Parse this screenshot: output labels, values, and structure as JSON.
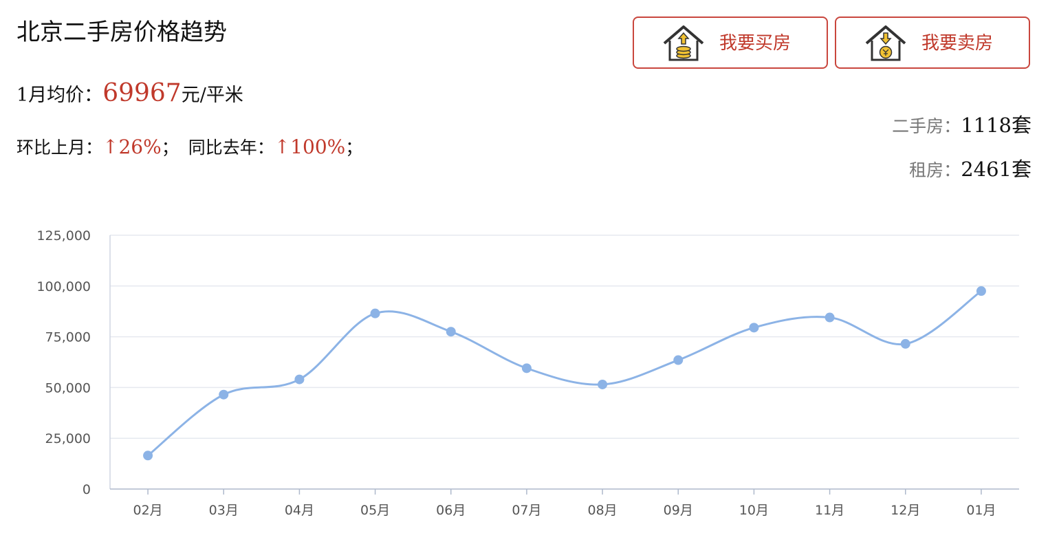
{
  "header": {
    "title": "北京二手房价格趋势",
    "avg_prefix": "1月均价：",
    "avg_value": "69967",
    "avg_unit": "元/平米",
    "mom_label": "环比上月：",
    "mom_value": "↑26%",
    "mom_sep": "；",
    "yoy_label": "同比去年：",
    "yoy_value": "↑100%",
    "yoy_sep": "；"
  },
  "buttons": {
    "buy_label": "我要买房",
    "sell_label": "我要卖房"
  },
  "stats": {
    "second_hand_label": "二手房：",
    "second_hand_value": "1118套",
    "rent_label": "租房：",
    "rent_value": "2461套"
  },
  "colors": {
    "accent": "#c0392b",
    "line": "#8cb3e6",
    "grid": "#e6e9ef",
    "axis_text": "#555555"
  },
  "icons": {
    "buy": "house-coin-up-icon",
    "sell": "house-coin-down-icon"
  },
  "chart_data": {
    "type": "line",
    "smooth": true,
    "categories": [
      "02月",
      "03月",
      "04月",
      "05月",
      "06月",
      "07月",
      "08月",
      "09月",
      "10月",
      "11月",
      "12月",
      "01月"
    ],
    "series": [
      {
        "values": [
          16500,
          46500,
          54000,
          86500,
          77500,
          59500,
          51500,
          63500,
          79500,
          84500,
          71500,
          97500
        ]
      }
    ],
    "ylim": [
      0,
      125000
    ],
    "yticks": [
      "0",
      "25,000",
      "50,000",
      "75,000",
      "100,000",
      "125,000"
    ],
    "grid": true
  }
}
